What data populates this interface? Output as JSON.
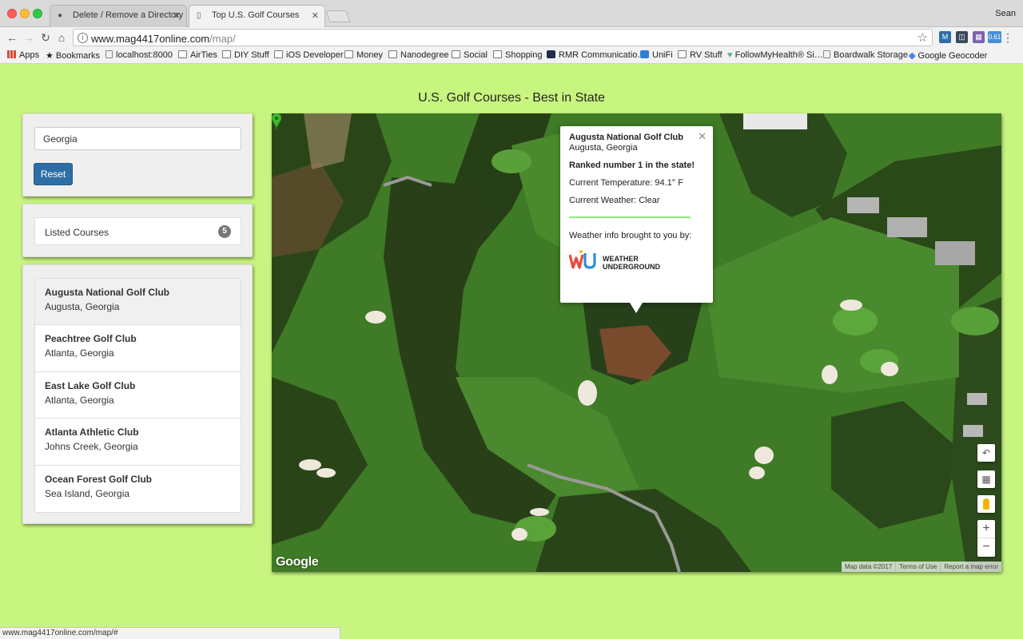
{
  "browser": {
    "tabs": [
      {
        "title": "Delete / Remove a Directory Li",
        "active": false
      },
      {
        "title": "Top U.S. Golf Courses",
        "active": true
      }
    ],
    "user": "Sean",
    "url_host": "www.mag4417online.com",
    "url_path": "/map/",
    "bookmarks": [
      {
        "label": "Apps",
        "icon": "apps-grid-icon"
      },
      {
        "label": "Bookmarks",
        "icon": "star-icon"
      },
      {
        "label": "localhost:8000",
        "icon": "page-icon"
      },
      {
        "label": "AirTies",
        "icon": "folder-icon"
      },
      {
        "label": "DIY Stuff",
        "icon": "folder-icon"
      },
      {
        "label": "iOS Developer",
        "icon": "folder-icon"
      },
      {
        "label": "Money",
        "icon": "folder-icon"
      },
      {
        "label": "Nanodegree",
        "icon": "folder-icon"
      },
      {
        "label": "Social",
        "icon": "folder-icon"
      },
      {
        "label": "Shopping",
        "icon": "folder-icon"
      },
      {
        "label": "RMR Communicatio…",
        "icon": "rmr-icon"
      },
      {
        "label": "UniFi",
        "icon": "unifi-icon"
      },
      {
        "label": "RV Stuff",
        "icon": "folder-icon"
      },
      {
        "label": "FollowMyHealth® Si…",
        "icon": "heart-icon"
      },
      {
        "label": "Boardwalk Storage",
        "icon": "page-icon"
      },
      {
        "label": "Google Geocoder",
        "icon": "google-icon"
      }
    ],
    "extension_badge": "0.61",
    "status_url": "www.mag4417online.com/map/#"
  },
  "page": {
    "title": "U.S. Golf Courses - Best in State",
    "search_value": "Georgia",
    "reset_label": "Reset",
    "listed_label": "Listed Courses",
    "listed_count": "5",
    "courses": [
      {
        "name": "Augusta National Golf Club",
        "location": "Augusta, Georgia"
      },
      {
        "name": "Peachtree Golf Club",
        "location": "Atlanta, Georgia"
      },
      {
        "name": "East Lake Golf Club",
        "location": "Atlanta, Georgia"
      },
      {
        "name": "Atlanta Athletic Club",
        "location": "Johns Creek, Georgia"
      },
      {
        "name": "Ocean Forest Golf Club",
        "location": "Sea Island, Georgia"
      }
    ]
  },
  "map": {
    "infowindow": {
      "name": "Augusta National Golf Club",
      "location": "Augusta, Georgia",
      "rank": "Ranked number 1 in the state!",
      "temperature": "Current Temperature: 94.1° F",
      "weather": "Current Weather: Clear",
      "credit": "Weather info brought to you by:",
      "wu_line1": "WEATHER",
      "wu_line2": "UNDERGROUND"
    },
    "google": "Google",
    "attribution": [
      "Map data ©2017",
      "Terms of Use",
      "Report a map error"
    ],
    "colors": {
      "grass": "#3f7a26",
      "trees": "#263f17",
      "sand": "#efe8dc",
      "path": "#9a9a96",
      "marker": "#3cb82f"
    }
  }
}
